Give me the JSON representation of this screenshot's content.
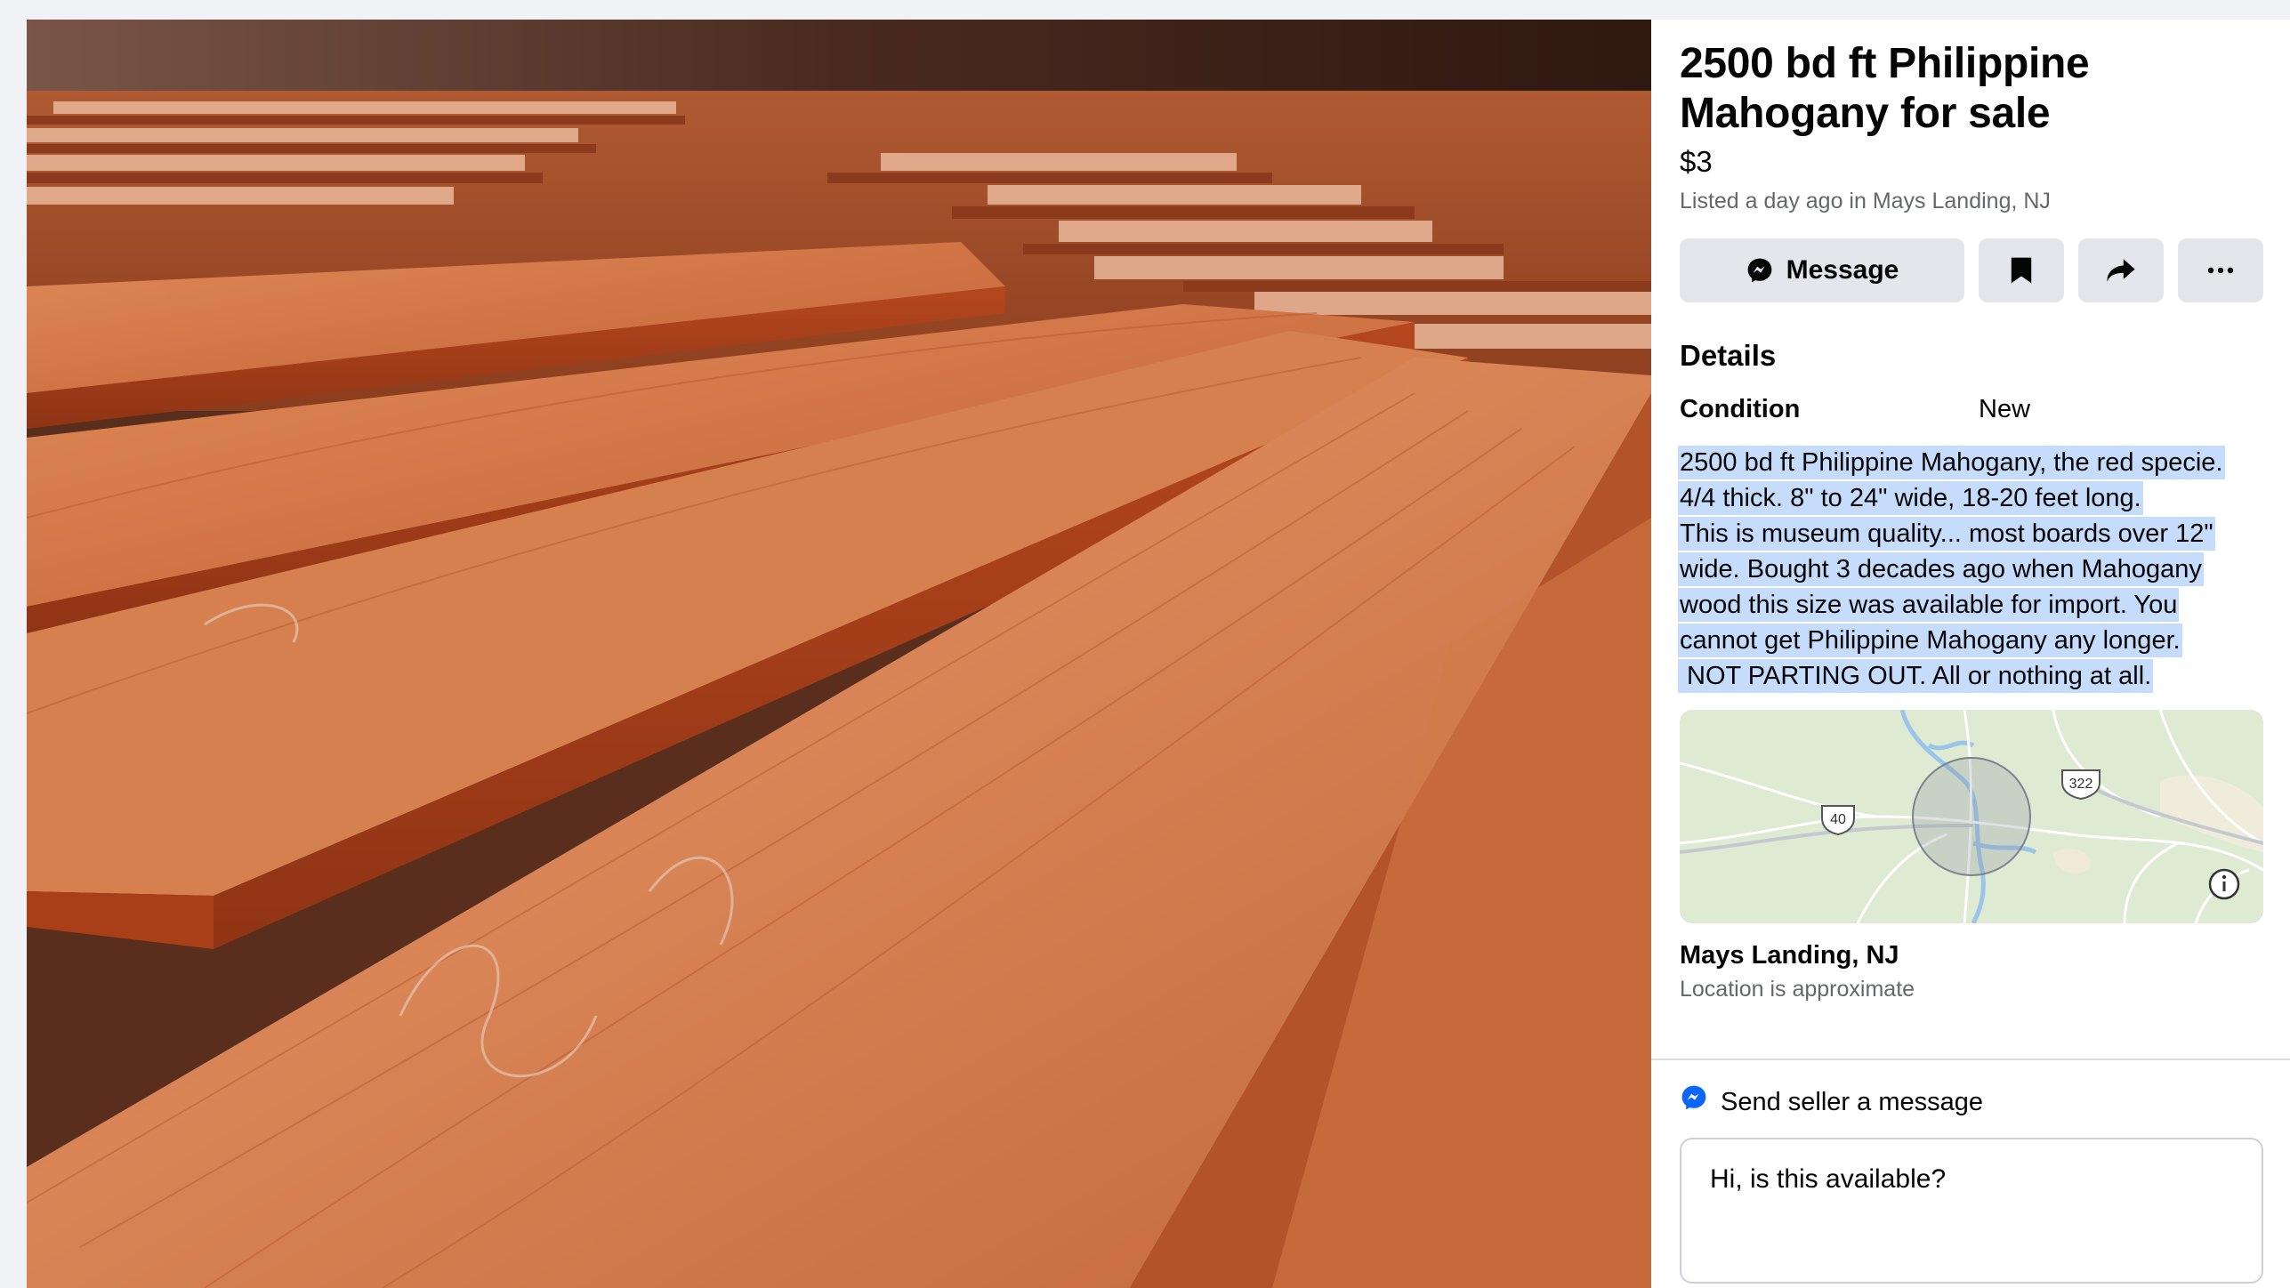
{
  "listing": {
    "title": "2500 bd ft Philippine Mahogany for sale",
    "price": "$3",
    "meta": "Listed a day ago in Mays Landing, NJ"
  },
  "actions": {
    "message_label": "Message",
    "save_icon": "bookmark-icon",
    "share_icon": "share-icon",
    "more_icon": "more-icon",
    "messenger_icon": "messenger-icon"
  },
  "details": {
    "heading": "Details",
    "condition_label": "Condition",
    "condition_value": "New",
    "description_lines": [
      "2500 bd ft Philippine Mahogany, the red specie.",
      "4/4 thick. 8\" to 24\" wide, 18-20 feet long.",
      "This is museum quality... most boards over 12\"",
      "wide. Bought 3 decades ago when Mahogany",
      "wood this size was available for import. You",
      "cannot get Philippine Mahogany any longer.",
      " NOT PARTING OUT. All or nothing at all."
    ]
  },
  "map": {
    "route_40": "40",
    "route_322": "322",
    "info_icon": "info-icon"
  },
  "location": {
    "name": "Mays Landing, NJ",
    "note": "Location is approximate"
  },
  "send": {
    "header": "Send seller a message",
    "input_value": "Hi, is this available?"
  },
  "colors": {
    "selection": "#c5dcfd",
    "button_bg": "#e4e6eb",
    "secondary_text": "#65676b",
    "messenger_blue": "#0866ff"
  }
}
